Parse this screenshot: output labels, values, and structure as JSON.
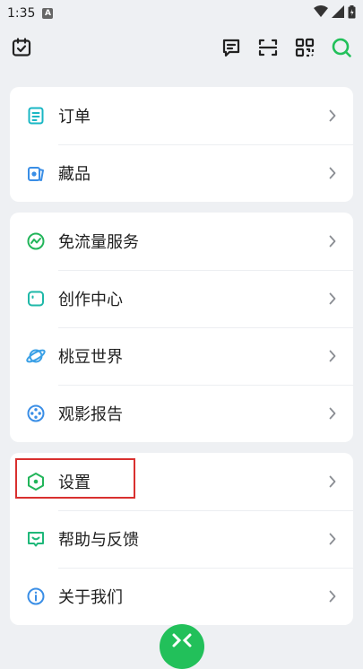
{
  "status_bar": {
    "time": "1:35",
    "notification_badge": "A"
  },
  "toolbar": {
    "left_icon": "calendar-check-icon",
    "right_icons": [
      "message-icon",
      "scan-icon",
      "qr-code-icon",
      "search-icon"
    ]
  },
  "menu": {
    "group1": [
      {
        "label": "订单",
        "icon": "order-list-icon",
        "color": "#19b7c4"
      },
      {
        "label": "藏品",
        "icon": "collection-icon",
        "color": "#3a8ee6"
      }
    ],
    "group2": [
      {
        "label": "免流量服务",
        "icon": "data-free-icon",
        "color": "#22b55a"
      },
      {
        "label": "创作中心",
        "icon": "creator-icon",
        "color": "#1fb8a8"
      },
      {
        "label": "桃豆世界",
        "icon": "planet-icon",
        "color": "#3aa0e6"
      },
      {
        "label": "观影报告",
        "icon": "film-reel-icon",
        "color": "#3a8ee6"
      }
    ],
    "group3": [
      {
        "label": "设置",
        "icon": "settings-hexagon-icon",
        "color": "#22b55a"
      },
      {
        "label": "帮助与反馈",
        "icon": "feedback-icon",
        "color": "#1fb87a"
      },
      {
        "label": "关于我们",
        "icon": "info-icon",
        "color": "#3a8ee6"
      }
    ]
  },
  "colors": {
    "accent": "#22c05a",
    "highlight": "#d9302f",
    "background": "#eef0f3"
  }
}
